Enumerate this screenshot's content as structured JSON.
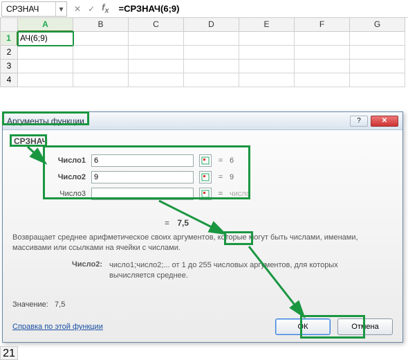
{
  "namebox": {
    "value": "СРЗНАЧ"
  },
  "formula": "=СРЗНАЧ(6;9)",
  "columns": [
    "A",
    "B",
    "C",
    "D",
    "E",
    "F",
    "G"
  ],
  "rows": [
    "1",
    "2",
    "3",
    "4"
  ],
  "cellA1": "АЧ(6;9)",
  "dialog": {
    "title": "Аргументы функции",
    "func": "СРЗНАЧ",
    "args": [
      {
        "label": "Число1",
        "value": "6",
        "result": "6",
        "bold": true
      },
      {
        "label": "Число2",
        "value": "9",
        "result": "9",
        "bold": true
      },
      {
        "label": "Число3",
        "value": "",
        "result": "число",
        "bold": false
      }
    ],
    "result_eq": "=",
    "result": "7,5",
    "desc": "Возвращает среднее арифметическое своих аргументов, которые могут быть числами, именами, массивами или ссылками на ячейки с числами.",
    "argdesc_label": "Число2:",
    "argdesc_text": "число1;число2;... от 1 до 255 числовых аргументов, для которых вычисляется среднее.",
    "value_label": "Значение:",
    "value": "7,5",
    "help": "Справка по этой функции",
    "ok": "ОК",
    "cancel": "Отмена",
    "help_icon": "?",
    "close_icon": "✕"
  },
  "fbar_icons": {
    "cancel": "✕",
    "enter": "✓"
  },
  "stub_row": "21"
}
